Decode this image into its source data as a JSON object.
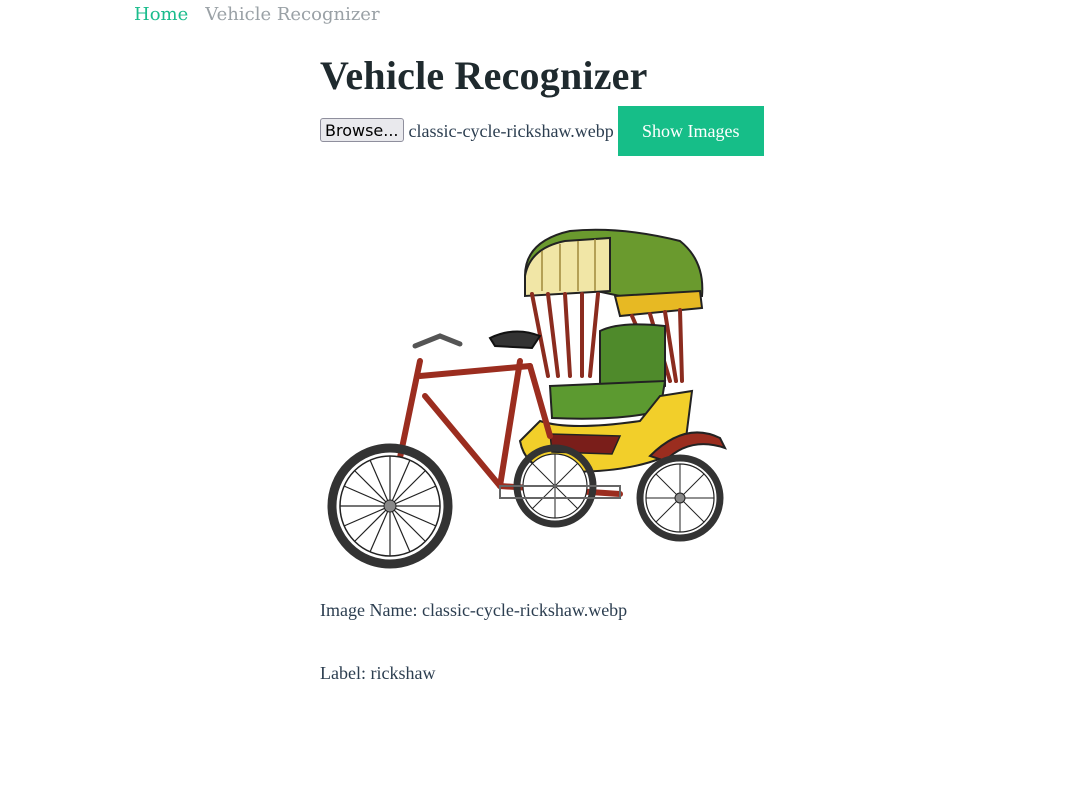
{
  "breadcrumb": {
    "home": "Home",
    "current": "Vehicle Recognizer"
  },
  "page": {
    "title": "Vehicle Recognizer"
  },
  "upload": {
    "browse_label": "Browse...",
    "selected_file": "classic-cycle-rickshaw.webp",
    "submit_label": "Show Images"
  },
  "result": {
    "image_name_text": "Image Name: classic-cycle-rickshaw.webp",
    "label_text": "Label: rickshaw"
  },
  "colors": {
    "accent": "#16be88",
    "link": "#1abc8c",
    "text": "#2c3e50"
  },
  "icons": {
    "preview_image": "cycle-rickshaw-illustration"
  }
}
